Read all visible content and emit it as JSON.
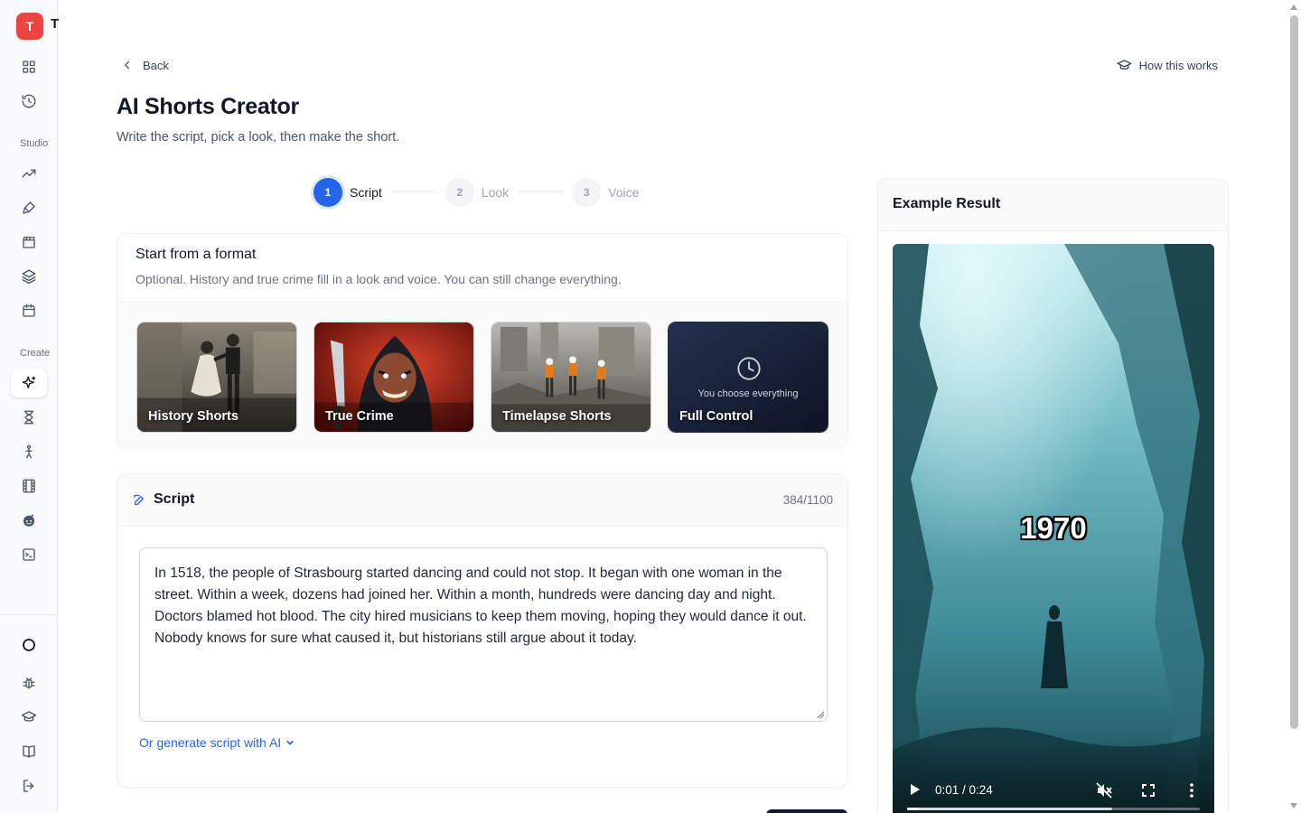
{
  "app": {
    "logo_text": "T",
    "logo_overflow_text": "T"
  },
  "sidebar": {
    "sections": {
      "studio": "Studio",
      "create": "Create"
    },
    "icons": [
      "dashboard-grid-icon",
      "history-icon",
      "trending-icon",
      "paint-brush-icon",
      "clapperboard-icon",
      "layers-icon",
      "calendar-icon",
      "sparkles-icon",
      "hourglass-icon",
      "figure-icon",
      "film-icon",
      "reddit-icon",
      "terminal-icon",
      "circle-icon",
      "bug-icon",
      "graduation-cap-icon",
      "book-icon",
      "logout-icon"
    ],
    "active": "sparkles-icon"
  },
  "header": {
    "back_label": "Back",
    "how_label": "How this works",
    "title": "AI Shorts Creator",
    "subtitle": "Write the script, pick a look, then make the short."
  },
  "stepper": {
    "steps": [
      {
        "num": "1",
        "label": "Script",
        "active": true
      },
      {
        "num": "2",
        "label": "Look",
        "active": false
      },
      {
        "num": "3",
        "label": "Voice",
        "active": false
      }
    ]
  },
  "format": {
    "title": "Start from a format",
    "description": "Optional. History and true crime fill in a look and voice. You can still change everything.",
    "tiles": [
      {
        "label": "History Shorts"
      },
      {
        "label": "True Crime"
      },
      {
        "label": "Timelapse Shorts"
      },
      {
        "label": "Full Control",
        "sub": "You choose everything"
      }
    ]
  },
  "script": {
    "title": "Script",
    "count": "384/1100",
    "text": "In 1518, the people of Strasbourg started dancing and could not stop. It began with one woman in the street. Within a week, dozens had joined her. Within a month, hundreds were dancing day and night. Doctors blamed hot blood. The city hired musicians to keep them moving, hoping they would dance it out. Nobody knows for sure what caused it, but historians still argue about it today.",
    "generate_label": "Or generate script with AI"
  },
  "example": {
    "title": "Example Result",
    "caption": "1970",
    "time": "0:01 / 0:24",
    "progress": 0.04,
    "buffered": 0.7
  },
  "colors": {
    "accent": "#2563eb",
    "logo": "#ef4444"
  }
}
